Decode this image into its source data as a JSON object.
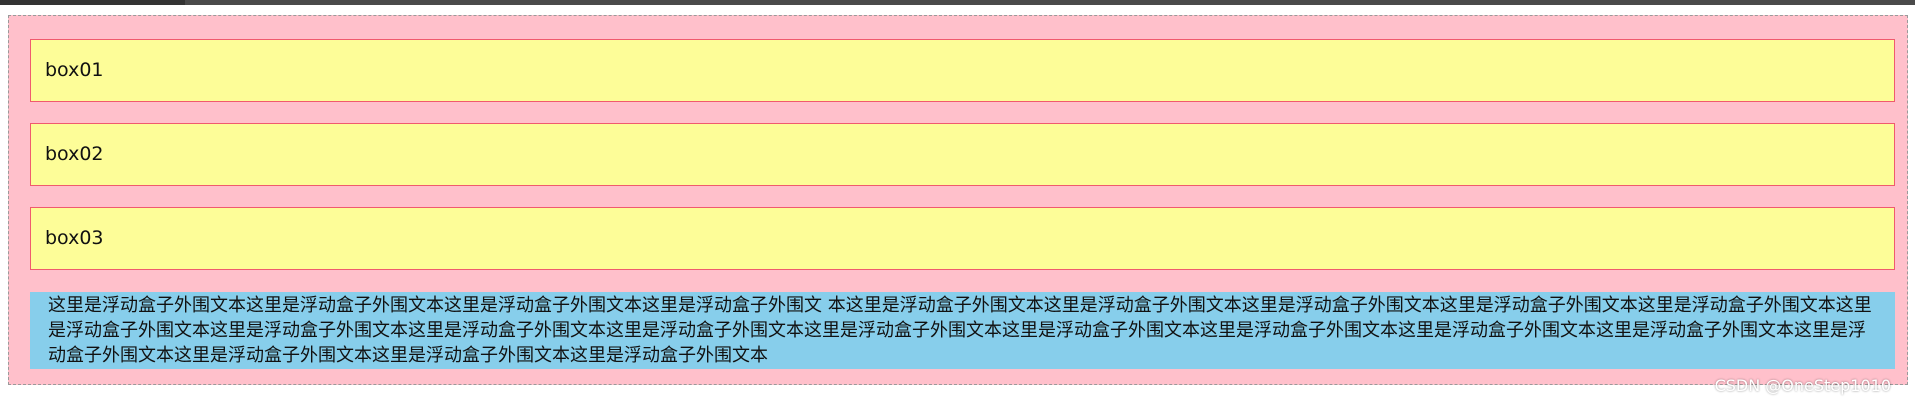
{
  "boxes": [
    {
      "label": "box01"
    },
    {
      "label": "box02"
    },
    {
      "label": "box03"
    }
  ],
  "float_text": "这里是浮动盒子外围文本这里是浮动盒子外围文本这里是浮动盒子外围文本这里是浮动盒子外围文 本这里是浮动盒子外围文本这里是浮动盒子外围文本这里是浮动盒子外围文本这里是浮动盒子外围文本这里是浮动盒子外围文本这里是浮动盒子外围文本这里是浮动盒子外围文本这里是浮动盒子外围文本这里是浮动盒子外围文本这里是浮动盒子外围文本这里是浮动盒子外围文本这里是浮动盒子外围文本这里是浮动盒子外围文本这里是浮动盒子外围文本这里是浮动盒子外围文本这里是浮动盒子外围文本这里是浮动盒子外围文本这里是浮动盒子外围文本",
  "watermark": "CSDN @OneStep1010",
  "colors": {
    "container_bg": "#ffc0cb",
    "box_bg": "#fdfd98",
    "box_border": "#f05a6e",
    "text_block_bg": "#87ceeb"
  }
}
